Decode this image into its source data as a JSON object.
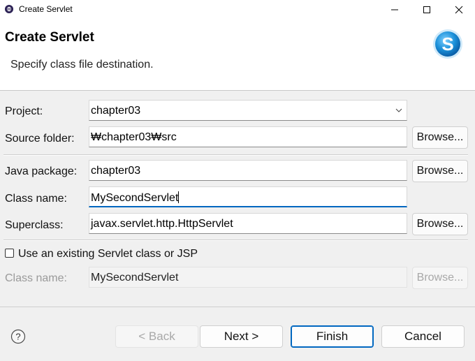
{
  "window": {
    "title": "Create Servlet",
    "app_icon": "eclipse-icon",
    "controls": [
      "minimize-icon",
      "maximize-icon",
      "close-icon"
    ]
  },
  "banner": {
    "title": "Create Servlet",
    "description": "Specify class file destination.",
    "logo_icon": "servlet-wizard-icon"
  },
  "form": {
    "project": {
      "label": "Project:",
      "value": "chapter03"
    },
    "source_folder": {
      "label": "Source folder:",
      "value": "₩chapter03₩src",
      "browse": "Browse..."
    },
    "java_package": {
      "label": "Java package:",
      "value": "chapter03",
      "browse": "Browse..."
    },
    "class_name": {
      "label": "Class name:",
      "value": "MySecondServlet"
    },
    "superclass": {
      "label": "Superclass:",
      "value": "javax.servlet.http.HttpServlet",
      "browse": "Browse..."
    },
    "use_existing": {
      "label": "Use an existing Servlet class or JSP",
      "checked": false
    },
    "existing_class_name": {
      "label": "Class name:",
      "value": "MySecondServlet",
      "browse": "Browse..."
    }
  },
  "buttons": {
    "back": "< Back",
    "next": "Next >",
    "finish": "Finish",
    "cancel": "Cancel"
  },
  "colors": {
    "accent": "#0067c0",
    "logo_blue": "#1a8fd8"
  }
}
